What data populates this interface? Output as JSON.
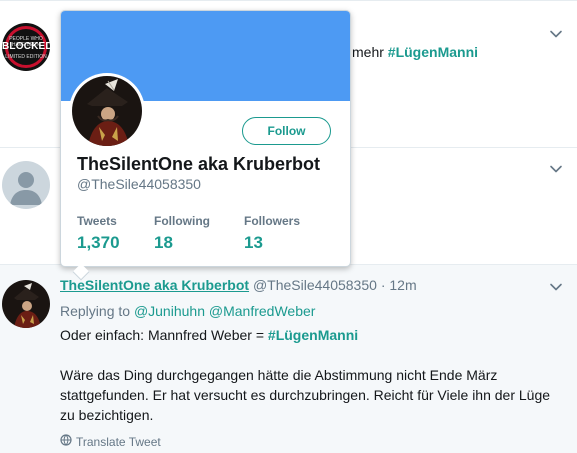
{
  "tweets": {
    "t1": {
      "avatar": {
        "top_text": "PEOPLE WHO HAVE BEEN",
        "main_text": "BLOCKED",
        "bottom_text": "LIMITED EDITION"
      },
      "text_word": "mehr",
      "hashtag": "#LügenManni"
    },
    "t3": {
      "display_name": "TheSilentOne aka Kruberbot",
      "handle": "@TheSile44058350",
      "separator": "·",
      "time": "12m",
      "replying_prefix": "Replying to",
      "mention1": "@Junihuhn",
      "mention2": "@ManfredWeber",
      "line1_text": "Oder einfach: Mannfred Weber =",
      "line1_hashtag": "#LügenManni",
      "paragraph2": "Wäre das Ding durchgegangen hätte die Abstimmung nicht Ende März stattgefunden. Er hat versucht es durchzubringen. Reicht für Viele ihn der Lüge zu bezichtigen.",
      "translate_label": "Translate Tweet"
    }
  },
  "popup": {
    "follow_label": "Follow",
    "display_name": "TheSilentOne aka Kruberbot",
    "handle": "@TheSile44058350",
    "stats": [
      {
        "label": "Tweets",
        "value": "1,370"
      },
      {
        "label": "Following",
        "value": "18"
      },
      {
        "label": "Followers",
        "value": "13"
      }
    ]
  },
  "colors": {
    "accent": "#1b9a8f",
    "banner": "#4d9af3",
    "muted": "#657786",
    "highlight_bg": "#f5f8fa"
  },
  "icons": [
    "chevron-down-icon",
    "globe-icon",
    "default-avatar-icon"
  ]
}
